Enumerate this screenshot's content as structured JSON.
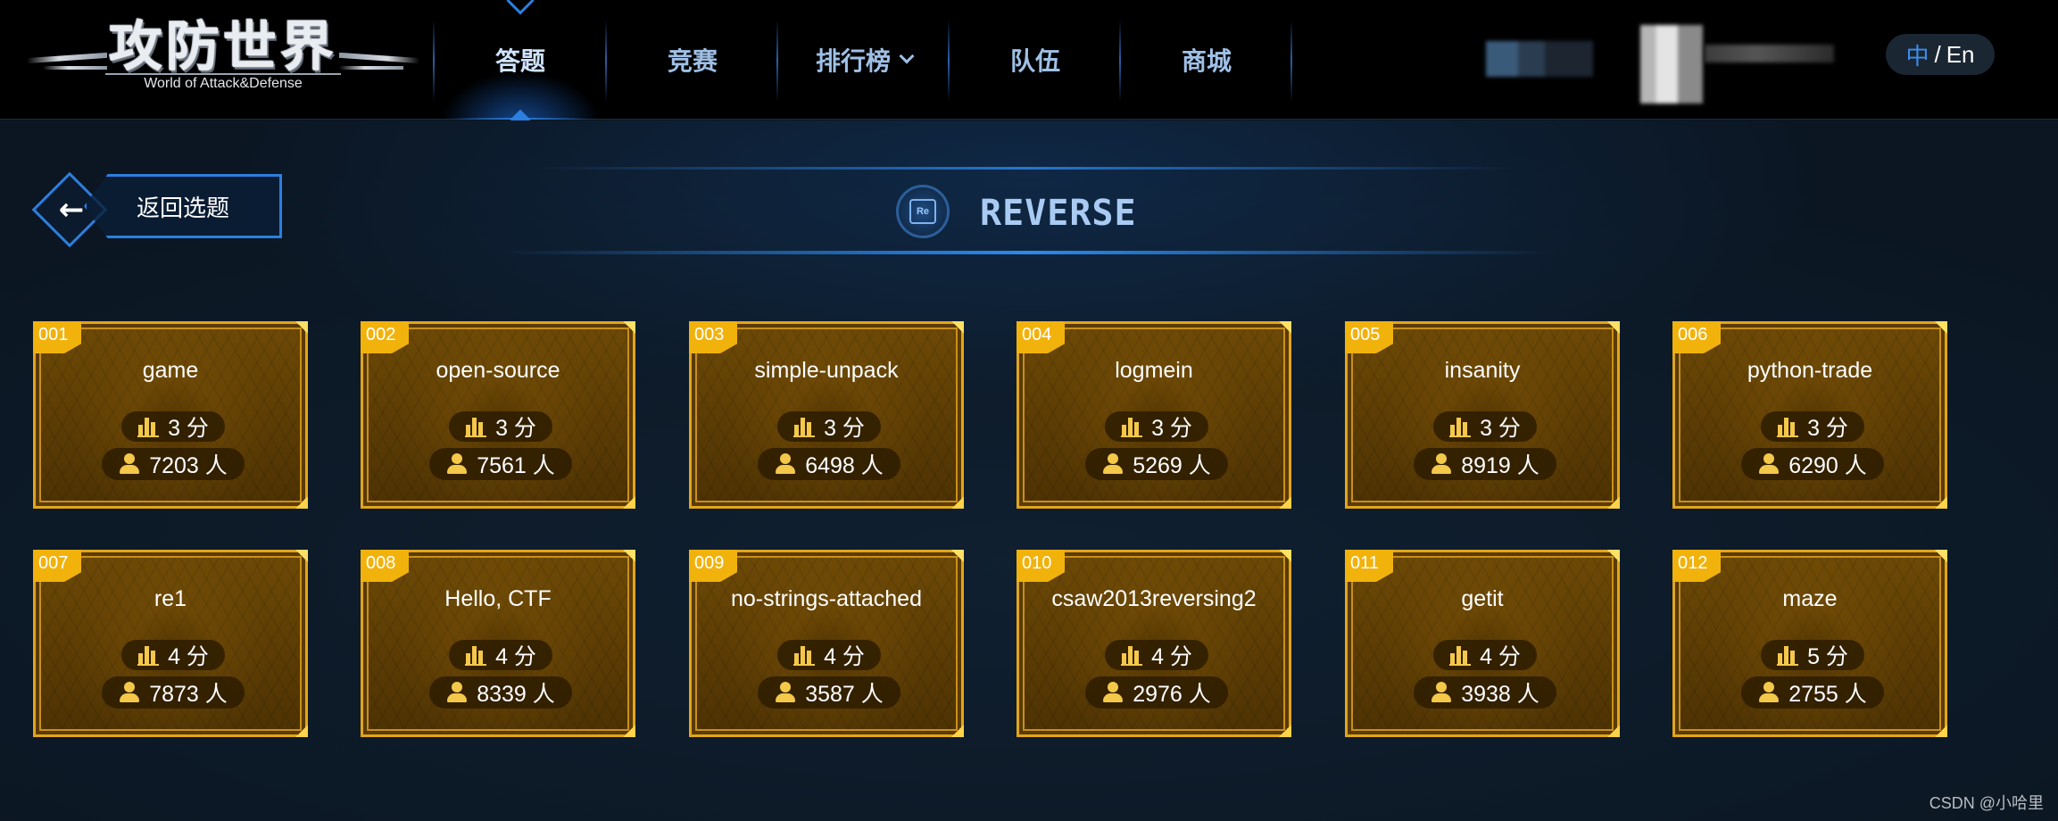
{
  "header": {
    "logo_title": "攻防世界",
    "logo_subtitle": "World of Attack&Defense",
    "nav": [
      {
        "label": "答题",
        "active": true
      },
      {
        "label": "竞赛"
      },
      {
        "label": "排行榜",
        "dropdown": true
      },
      {
        "label": "队伍"
      },
      {
        "label": "商城"
      }
    ],
    "lang": {
      "current": "中",
      "separator": "/",
      "other": "En"
    }
  },
  "main": {
    "back_label": "返回选题",
    "back_icon": "arrow-left-icon",
    "category_icon_text": "Re",
    "category_title": "REVERSE",
    "score_unit": "分",
    "solver_unit": "人",
    "cards": [
      {
        "num": "001",
        "name": "game",
        "score": "3 分",
        "solvers": "7203 人"
      },
      {
        "num": "002",
        "name": "open-source",
        "score": "3 分",
        "solvers": "7561 人"
      },
      {
        "num": "003",
        "name": "simple-unpack",
        "score": "3 分",
        "solvers": "6498 人"
      },
      {
        "num": "004",
        "name": "logmein",
        "score": "3 分",
        "solvers": "5269 人"
      },
      {
        "num": "005",
        "name": "insanity",
        "score": "3 分",
        "solvers": "8919 人"
      },
      {
        "num": "006",
        "name": "python-trade",
        "score": "3 分",
        "solvers": "6290 人"
      },
      {
        "num": "007",
        "name": "re1",
        "score": "4 分",
        "solvers": "7873 人"
      },
      {
        "num": "008",
        "name": "Hello, CTF",
        "score": "4 分",
        "solvers": "8339 人"
      },
      {
        "num": "009",
        "name": "no-strings-attached",
        "score": "4 分",
        "solvers": "3587 人"
      },
      {
        "num": "010",
        "name": "csaw2013reversing2",
        "score": "4 分",
        "solvers": "2976 人"
      },
      {
        "num": "011",
        "name": "getit",
        "score": "4 分",
        "solvers": "3938 人"
      },
      {
        "num": "012",
        "name": "maze",
        "score": "5 分",
        "solvers": "2755 人"
      }
    ]
  },
  "watermark": "CSDN @小哈里",
  "colors": {
    "accent_blue": "#2b7fe0",
    "card_gold": "#e2a51a",
    "card_badge": "#f2b20c",
    "card_bg": "#5a3b04"
  }
}
